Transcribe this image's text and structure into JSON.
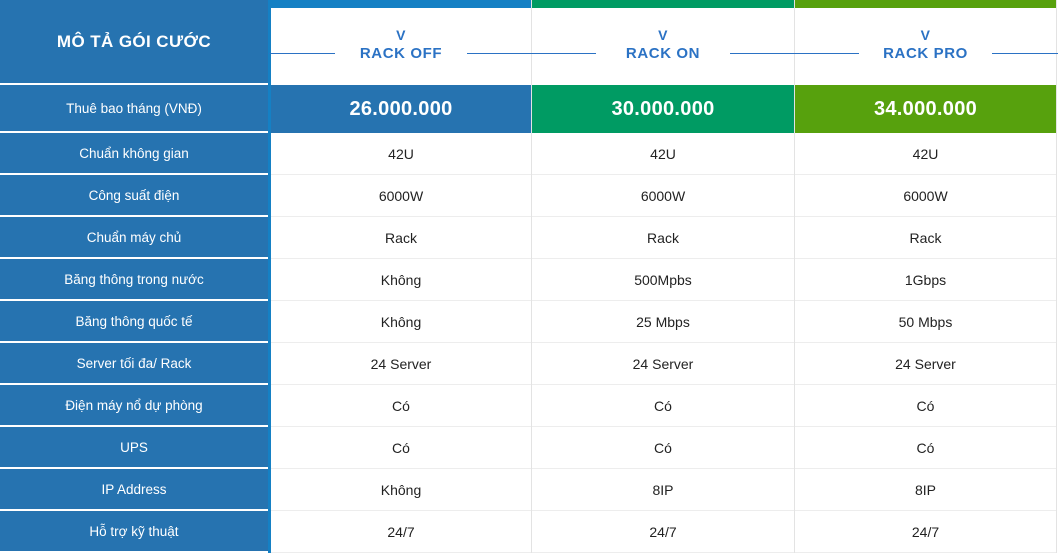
{
  "colors": {
    "sidebar_blue": "#2673b0",
    "accent_blue": "#1580c4",
    "accent_green": "#009b63",
    "accent_lime": "#57a10d",
    "header_text_blue": "#2b72c4",
    "divider_strong": "#1580c4",
    "divider_light": "#e3e3e3"
  },
  "sidebar": {
    "title": "MÔ TẢ GÓI CƯỚC",
    "price_label": "Thuê bao tháng (VNĐ)",
    "rows": [
      {
        "label": "Chuẩn không gian"
      },
      {
        "label": "Công suất điện"
      },
      {
        "label": "Chuẩn máy chủ"
      },
      {
        "label": "Băng thông trong nước"
      },
      {
        "label": "Băng thông quốc tế"
      },
      {
        "label": "Server tối đa/ Rack"
      },
      {
        "label": "Điện máy nổ dự phòng"
      },
      {
        "label": "UPS"
      },
      {
        "label": "IP Address"
      },
      {
        "label": "Hỗ trợ kỹ thuật"
      }
    ]
  },
  "packages": [
    {
      "brand": "V",
      "name": "RACK OFF",
      "price": "26.000.000",
      "accent": "#1580c4",
      "price_bg": "#2673b0",
      "values": [
        "42U",
        "6000W",
        "Rack",
        "Không",
        "Không",
        "24 Server",
        "Có",
        "Có",
        "Không",
        "24/7"
      ]
    },
    {
      "brand": "V",
      "name": "RACK ON",
      "price": "30.000.000",
      "accent": "#009b63",
      "price_bg": "#009b63",
      "values": [
        "42U",
        "6000W",
        "Rack",
        "500Mpbs",
        "25 Mbps",
        "24 Server",
        "Có",
        "Có",
        "8IP",
        "24/7"
      ]
    },
    {
      "brand": "V",
      "name": "RACK PRO",
      "price": "34.000.000",
      "accent": "#57a10d",
      "price_bg": "#57a10d",
      "values": [
        "42U",
        "6000W",
        "Rack",
        "1Gbps",
        "50 Mbps",
        "24 Server",
        "Có",
        "Có",
        "8IP",
        "24/7"
      ]
    }
  ]
}
